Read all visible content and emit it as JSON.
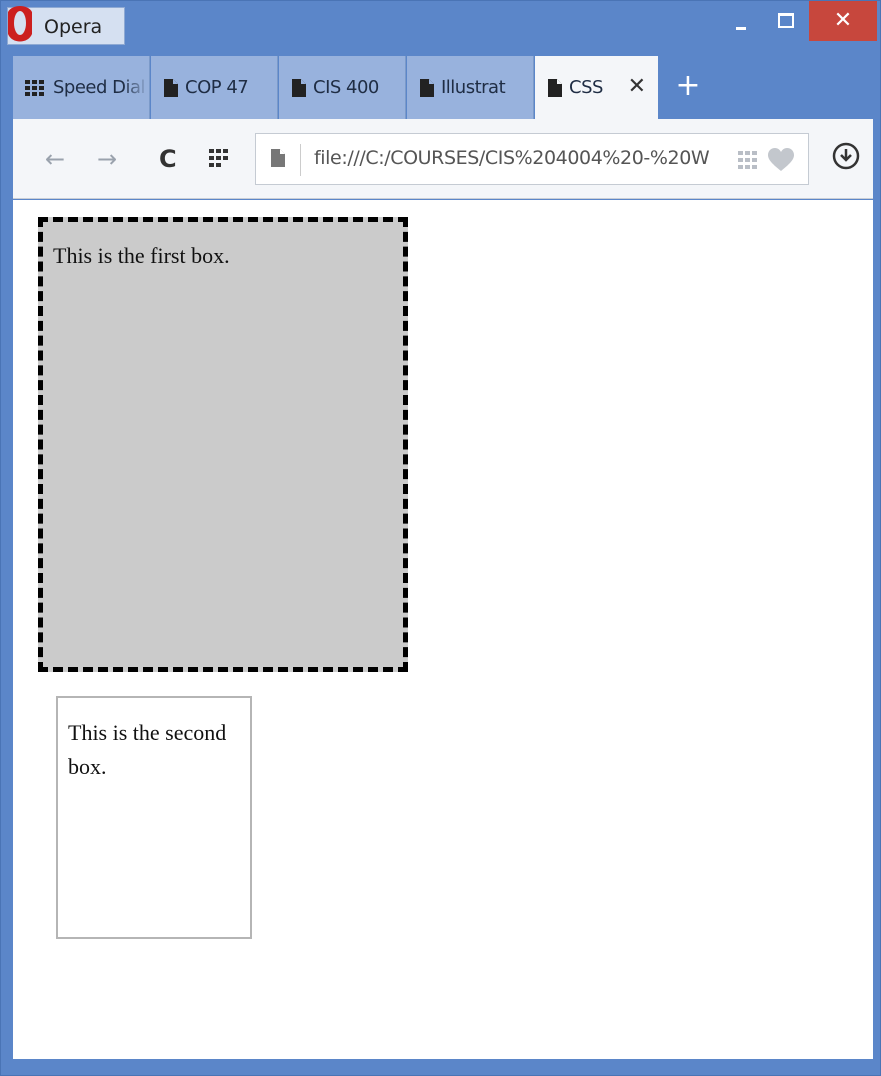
{
  "window": {
    "app_name": "Opera",
    "minimize_label": "_",
    "close_label": "✕",
    "colors": {
      "frame": "#5b86c9",
      "close": "#c7473d",
      "tab_inactive": "#98b2dd",
      "tab_active": "#f4f6f9"
    }
  },
  "tabs": [
    {
      "label": "Speed Dial",
      "icon": "speed-dial-icon"
    },
    {
      "label": "COP 47",
      "icon": "page-icon"
    },
    {
      "label": "CIS 400",
      "icon": "page-icon"
    },
    {
      "label": "Illustrat",
      "icon": "page-icon"
    },
    {
      "label": "CSS",
      "icon": "page-icon",
      "active": true
    }
  ],
  "tab_close_label": "✕",
  "new_tab_label": "+",
  "toolbar": {
    "back_icon": "←",
    "forward_icon": "→",
    "reload_icon": "C",
    "url": "file:///C:/COURSES/CIS%204004%20-%20W"
  },
  "page": {
    "box1_text": "This is the first box.",
    "box2_text": "This is the second box."
  }
}
